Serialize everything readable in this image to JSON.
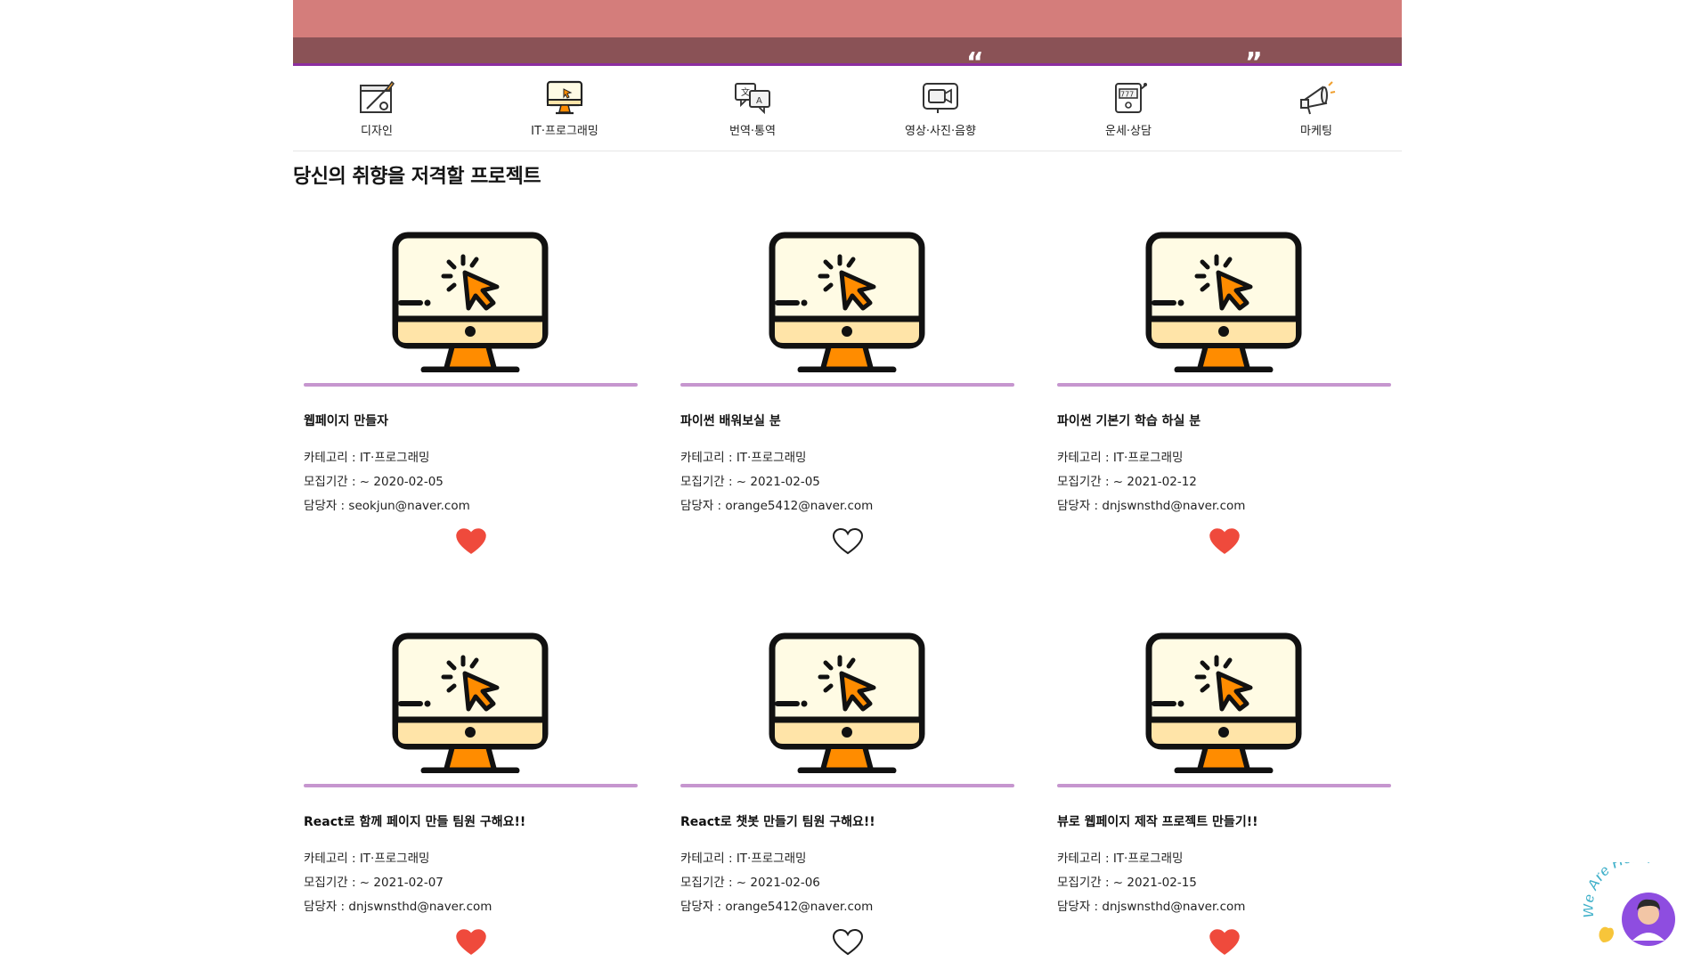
{
  "categories": [
    {
      "label": "디자인",
      "icon": "design-icon"
    },
    {
      "label": "IT·프로그래밍",
      "icon": "computer-icon"
    },
    {
      "label": "번역·통역",
      "icon": "translate-icon"
    },
    {
      "label": "영상·사진·음향",
      "icon": "video-camera-icon"
    },
    {
      "label": "운세·상담",
      "icon": "slot-machine-icon"
    },
    {
      "label": "마케팅",
      "icon": "megaphone-icon"
    }
  ],
  "section": {
    "title": "당신의 취향을 저격할 프로젝트"
  },
  "labels": {
    "category": "카테고리 : ",
    "period": "모집기간 : ~ ",
    "manager": "담당자 : "
  },
  "projects": [
    {
      "title": "웹페이지 만들자",
      "category": "IT·프로그래밍",
      "deadline": "2020-02-05",
      "manager": "seokjun@naver.com",
      "liked": true
    },
    {
      "title": "파이썬 배워보실 분",
      "category": "IT·프로그래밍",
      "deadline": "2021-02-05",
      "manager": "orange5412@naver.com",
      "liked": false
    },
    {
      "title": "파이썬 기본기 학습 하실 분",
      "category": "IT·프로그래밍",
      "deadline": "2021-02-12",
      "manager": "dnjswnsthd@naver.com",
      "liked": true
    },
    {
      "title": "React로 함께 페이지 만들 팀원 구해요!!",
      "category": "IT·프로그래밍",
      "deadline": "2021-02-07",
      "manager": "dnjswnsthd@naver.com",
      "liked": true
    },
    {
      "title": "React로 챗봇 만들기 팀원 구해요!!",
      "category": "IT·프로그래밍",
      "deadline": "2021-02-06",
      "manager": "orange5412@naver.com",
      "liked": false
    },
    {
      "title": "뷰로 웹페이지 제작 프로젝트 만들기!!",
      "category": "IT·프로그래밍",
      "deadline": "2021-02-15",
      "manager": "dnjswnsthd@naver.com",
      "liked": true
    }
  ],
  "badge": {
    "text": "We Are Here!"
  },
  "colors": {
    "accent": "#c696cf",
    "heart": "#ef4a3c",
    "banner": "#d47d7b",
    "banner_dark": "#8a5256"
  }
}
